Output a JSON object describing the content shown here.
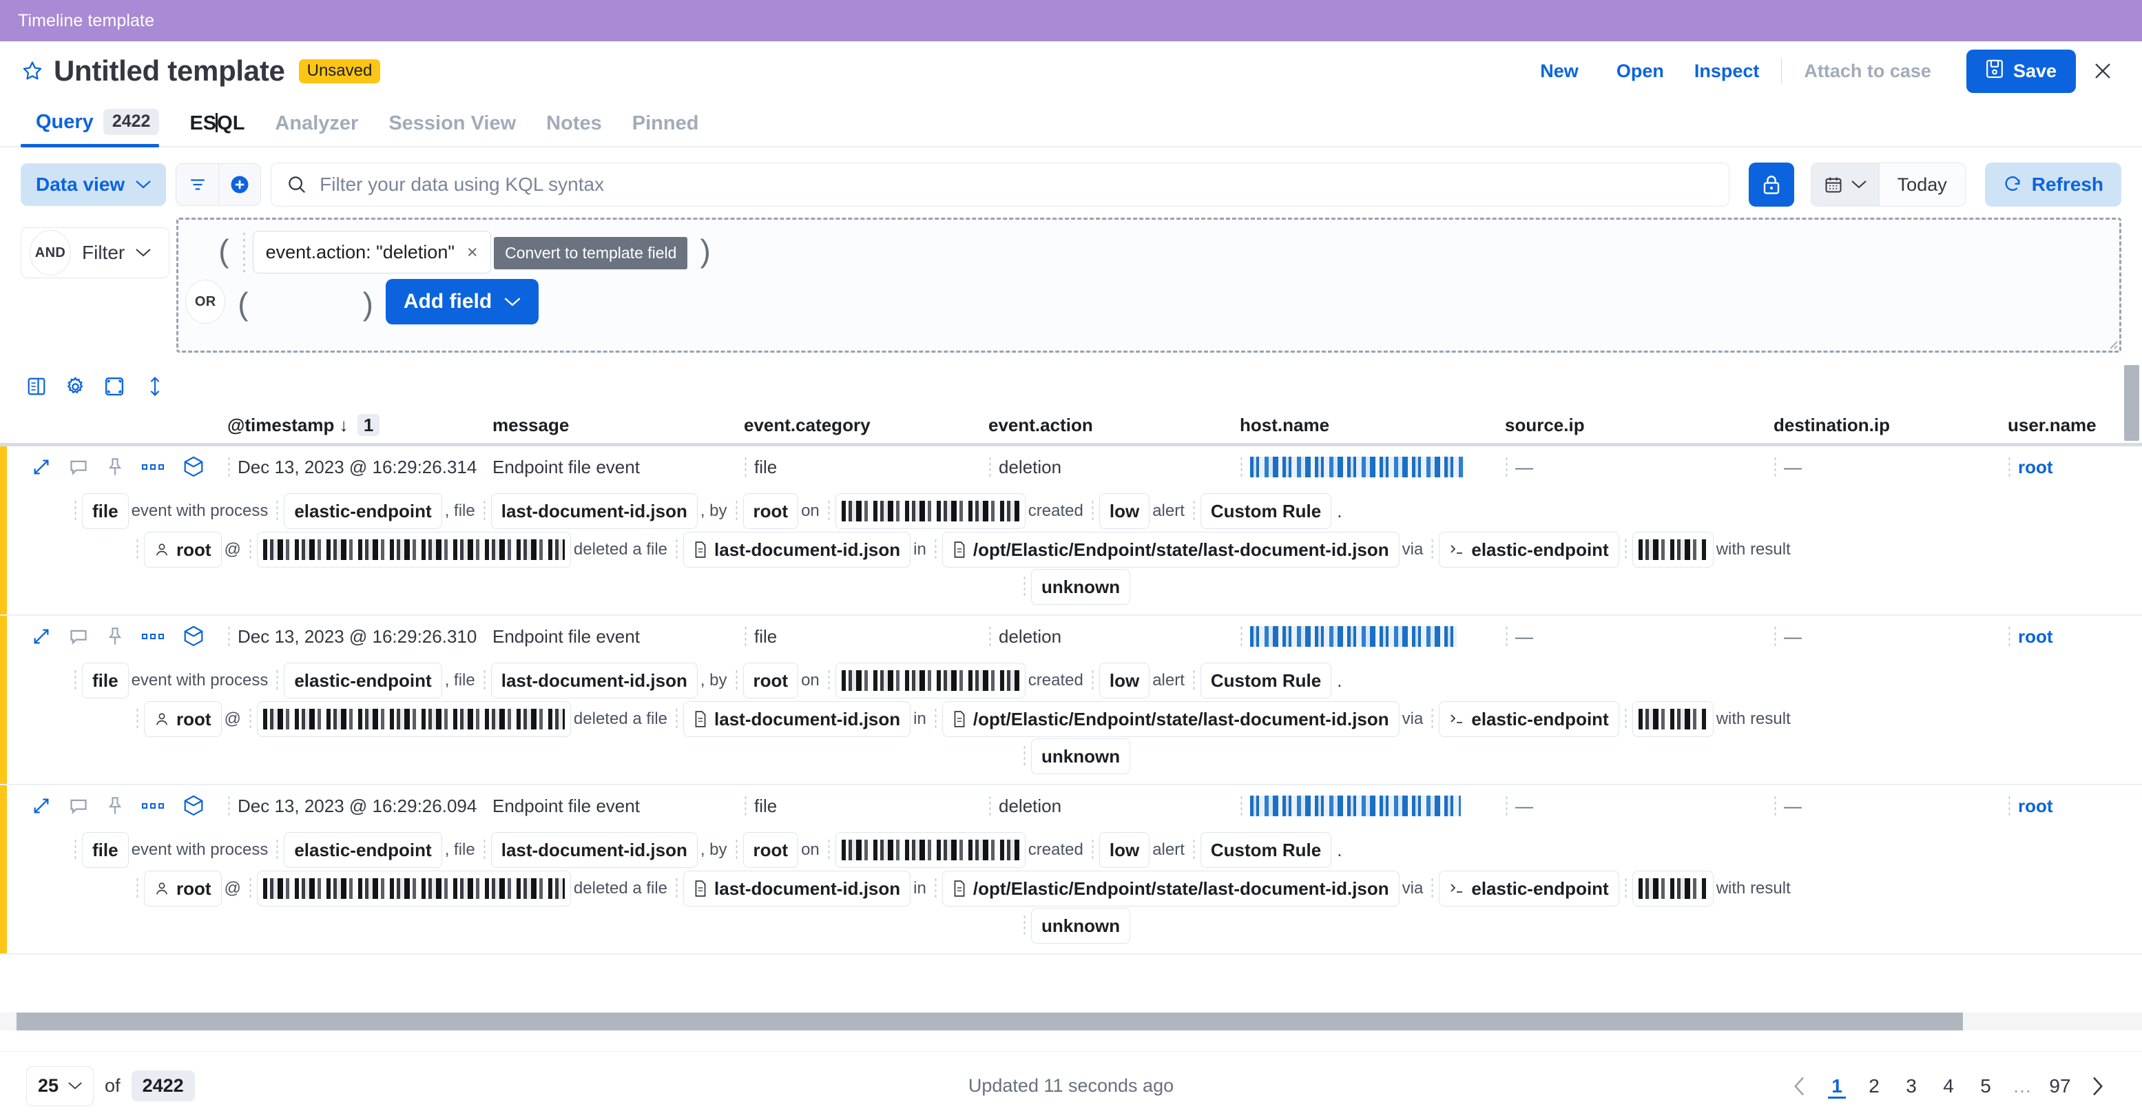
{
  "breadcrumb": {
    "label": "Timeline template"
  },
  "header": {
    "title": "Untitled template",
    "badge": "Unsaved",
    "actions": {
      "new": "New",
      "open": "Open",
      "inspect": "Inspect",
      "attach_to_case": "Attach to case",
      "save": "Save"
    }
  },
  "tabs": [
    {
      "label": "Query",
      "count": "2422",
      "state": "active"
    },
    {
      "label": "ES|QL",
      "state": "dark"
    },
    {
      "label": "Analyzer",
      "state": "muted"
    },
    {
      "label": "Session View",
      "state": "muted"
    },
    {
      "label": "Notes",
      "state": "muted"
    },
    {
      "label": "Pinned",
      "state": "muted"
    }
  ],
  "search": {
    "data_view_label": "Data view",
    "kql_placeholder": "Filter your data using KQL syntax",
    "kql_value": "",
    "today_label": "Today",
    "refresh_label": "Refresh"
  },
  "filter_builder": {
    "and_chip": "AND",
    "filter_label": "Filter",
    "or_chip": "OR",
    "open_paren": "(",
    "close_paren": ")",
    "condition": "event.action: \"deletion\"",
    "condition_remove": "×",
    "tooltip": "Convert to template field",
    "add_field_label": "Add field"
  },
  "grid": {
    "columns": [
      "@timestamp",
      "message",
      "event.category",
      "event.action",
      "host.name",
      "source.ip",
      "destination.ip",
      "user.name"
    ],
    "sort_indicator": "↓",
    "sort_order": "1",
    "rows": [
      {
        "timestamp": "Dec 13, 2023 @ 16:29:26.314",
        "message": "Endpoint file event",
        "event_category": "file",
        "event_action": "deletion",
        "host_name": "[redacted]",
        "source_ip": "—",
        "destination_ip": "—",
        "user_name": "root",
        "detail_line1": {
          "category_chip": "file",
          "text_a": "event with process",
          "process_chip": "elastic-endpoint",
          "text_b": ", file",
          "file_chip": "last-document-id.json",
          "text_c": ", by",
          "user_chip": "root",
          "text_d": "on",
          "host_chip": "[redacted]",
          "text_e": "created",
          "severity_chip": "low",
          "text_f": "alert",
          "rule_chip": "Custom Rule",
          "text_g": "."
        },
        "detail_line2": {
          "user_chip": "root",
          "at": "@",
          "host_chip": "[redacted]",
          "action_text": "deleted a file",
          "file_chip": "last-document-id.json",
          "in_text": "in",
          "path_chip": "/opt/Elastic/Endpoint/state/last-document-id.json",
          "via_text": "via",
          "process_chip": "elastic-endpoint",
          "pid_chip": "[redacted]",
          "result_text": "with result",
          "result_chip": "unknown"
        }
      },
      {
        "timestamp": "Dec 13, 2023 @ 16:29:26.310",
        "message": "Endpoint file event",
        "event_category": "file",
        "event_action": "deletion",
        "host_name": "[redacted]",
        "source_ip": "—",
        "destination_ip": "—",
        "user_name": "root",
        "detail_line1": {
          "category_chip": "file",
          "text_a": "event with process",
          "process_chip": "elastic-endpoint",
          "text_b": ", file",
          "file_chip": "last-document-id.json",
          "text_c": ", by",
          "user_chip": "root",
          "text_d": "on",
          "host_chip": "[redacted]",
          "text_e": "created",
          "severity_chip": "low",
          "text_f": "alert",
          "rule_chip": "Custom Rule",
          "text_g": "."
        },
        "detail_line2": {
          "user_chip": "root",
          "at": "@",
          "host_chip": "[redacted]",
          "action_text": "deleted a file",
          "file_chip": "last-document-id.json",
          "in_text": "in",
          "path_chip": "/opt/Elastic/Endpoint/state/last-document-id.json",
          "via_text": "via",
          "process_chip": "elastic-endpoint",
          "pid_chip": "[redacted]",
          "result_text": "with result",
          "result_chip": "unknown"
        }
      },
      {
        "timestamp": "Dec 13, 2023 @ 16:29:26.094",
        "message": "Endpoint file event",
        "event_category": "file",
        "event_action": "deletion",
        "host_name": "[redacted]",
        "source_ip": "—",
        "destination_ip": "—",
        "user_name": "root",
        "detail_line1": {
          "category_chip": "file",
          "text_a": "event with process",
          "process_chip": "elastic-endpoint",
          "text_b": ", file",
          "file_chip": "last-document-id.json",
          "text_c": ", by",
          "user_chip": "root",
          "text_d": "on",
          "host_chip": "[redacted]",
          "text_e": "created",
          "severity_chip": "low",
          "text_f": "alert",
          "rule_chip": "Custom Rule",
          "text_g": "."
        },
        "detail_line2": {
          "user_chip": "root",
          "at": "@",
          "host_chip": "[redacted]",
          "action_text": "deleted a file",
          "file_chip": "last-document-id.json",
          "in_text": "in",
          "path_chip": "/opt/Elastic/Endpoint/state/last-document-id.json",
          "via_text": "via",
          "process_chip": "elastic-endpoint",
          "pid_chip": "[redacted]",
          "result_text": "with result",
          "result_chip": "unknown"
        }
      }
    ]
  },
  "footer": {
    "per_page": "25",
    "of_label": "of",
    "total": "2422",
    "updated": "Updated 11 seconds ago",
    "pages": [
      "1",
      "2",
      "3",
      "4",
      "5",
      "…",
      "97"
    ],
    "current_page": "1"
  },
  "colors": {
    "accent": "#0b64dd",
    "breadcrumb_bar": "#a98ad4",
    "badge_unsaved": "#fec514",
    "row_marker": "#fec514",
    "muted_text": "#a2abba"
  }
}
